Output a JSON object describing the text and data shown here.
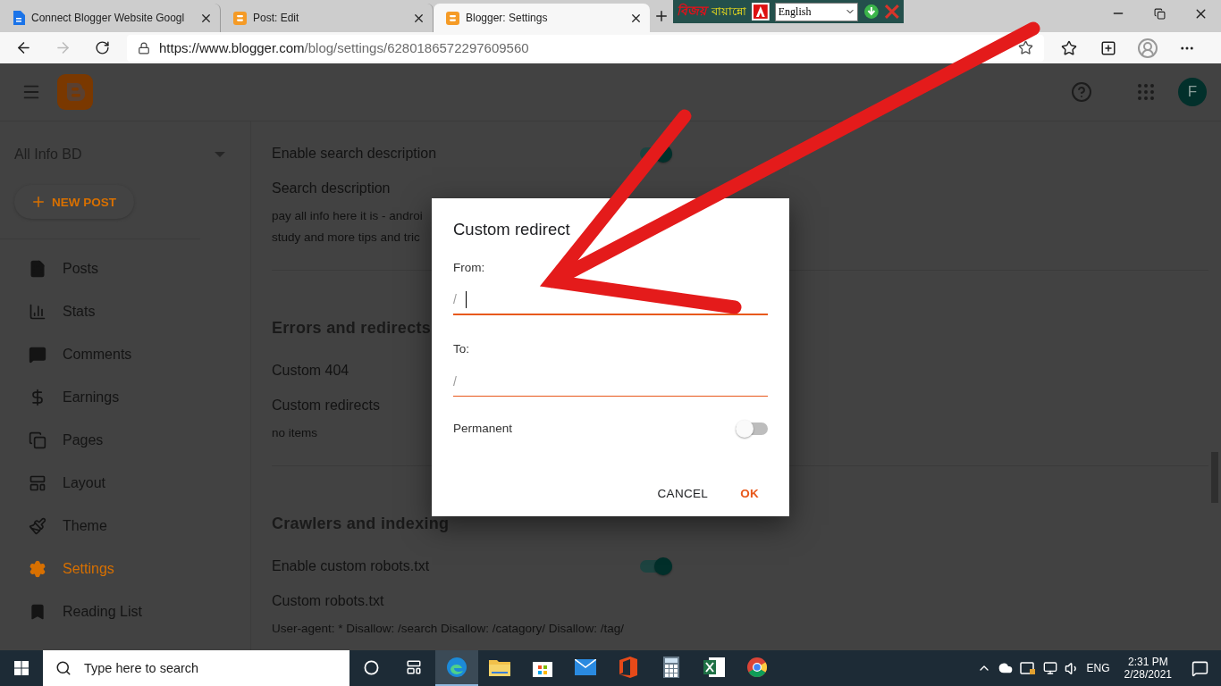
{
  "browser": {
    "tabs": [
      {
        "title": "Connect Blogger Website Googl",
        "kind": "doc",
        "selected": false
      },
      {
        "title": "Post: Edit",
        "kind": "blogger",
        "selected": false
      },
      {
        "title": "Blogger: Settings",
        "kind": "blogger",
        "selected": true
      }
    ],
    "url_host": "https://www.blogger.com",
    "url_path": "/blog/settings/6280186572297609560"
  },
  "keyboard_tool": {
    "logo": "বিজয়",
    "name": "বায়ান্নো",
    "language": "English"
  },
  "blog": {
    "name": "All Info BD",
    "new_post": "NEW POST",
    "avatar": "F"
  },
  "nav": [
    {
      "label": "Posts",
      "kind": "posts",
      "selected": false
    },
    {
      "label": "Stats",
      "kind": "stats",
      "selected": false
    },
    {
      "label": "Comments",
      "kind": "comments",
      "selected": false
    },
    {
      "label": "Earnings",
      "kind": "earnings",
      "selected": false
    },
    {
      "label": "Pages",
      "kind": "pages",
      "selected": false
    },
    {
      "label": "Layout",
      "kind": "layout",
      "selected": false
    },
    {
      "label": "Theme",
      "kind": "theme",
      "selected": false
    },
    {
      "label": "Settings",
      "kind": "settings",
      "selected": true
    },
    {
      "label": "Reading List",
      "kind": "reading",
      "selected": false
    }
  ],
  "settings": [
    {
      "kind": "toggle",
      "label": "Enable search description",
      "on": true
    },
    {
      "kind": "text",
      "label": "Search description",
      "lines": [
        "pay all info here it is - androi",
        "study and more tips and tric"
      ]
    },
    {
      "kind": "divider"
    },
    {
      "kind": "heading",
      "label": "Errors and redirects"
    },
    {
      "kind": "text",
      "label": "Custom 404"
    },
    {
      "kind": "text",
      "label": "Custom redirects",
      "lines": [
        "no items"
      ]
    },
    {
      "kind": "divider"
    },
    {
      "kind": "heading",
      "label": "Crawlers and indexing"
    },
    {
      "kind": "toggle",
      "label": "Enable custom robots.txt",
      "on": true
    },
    {
      "kind": "text",
      "label": "Custom robots.txt",
      "lines": [
        "User-agent: * Disallow: /search Disallow: /catagory/ Disallow: /tag/"
      ]
    }
  ],
  "dialog": {
    "title": "Custom redirect",
    "fields": [
      {
        "label": "From:",
        "prefix": "/",
        "focused": true
      },
      {
        "label": "To:",
        "prefix": "/",
        "focused": false
      }
    ],
    "toggle": {
      "label": "Permanent",
      "on": false
    },
    "buttons": [
      {
        "label": "CANCEL",
        "primary": false
      },
      {
        "label": "OK",
        "primary": true
      }
    ]
  },
  "taskbar": {
    "search_placeholder": "Type here to search",
    "apps": [
      {
        "kind": "edge",
        "selected": true
      },
      {
        "kind": "explorer",
        "selected": false
      },
      {
        "kind": "store",
        "selected": false
      },
      {
        "kind": "mail",
        "selected": false
      },
      {
        "kind": "office",
        "selected": false
      },
      {
        "kind": "calculator",
        "selected": false
      },
      {
        "kind": "excel",
        "selected": false
      },
      {
        "kind": "chrome",
        "selected": false
      }
    ],
    "language": "ENG",
    "time": "2:31 PM",
    "date": "2/28/2021"
  }
}
